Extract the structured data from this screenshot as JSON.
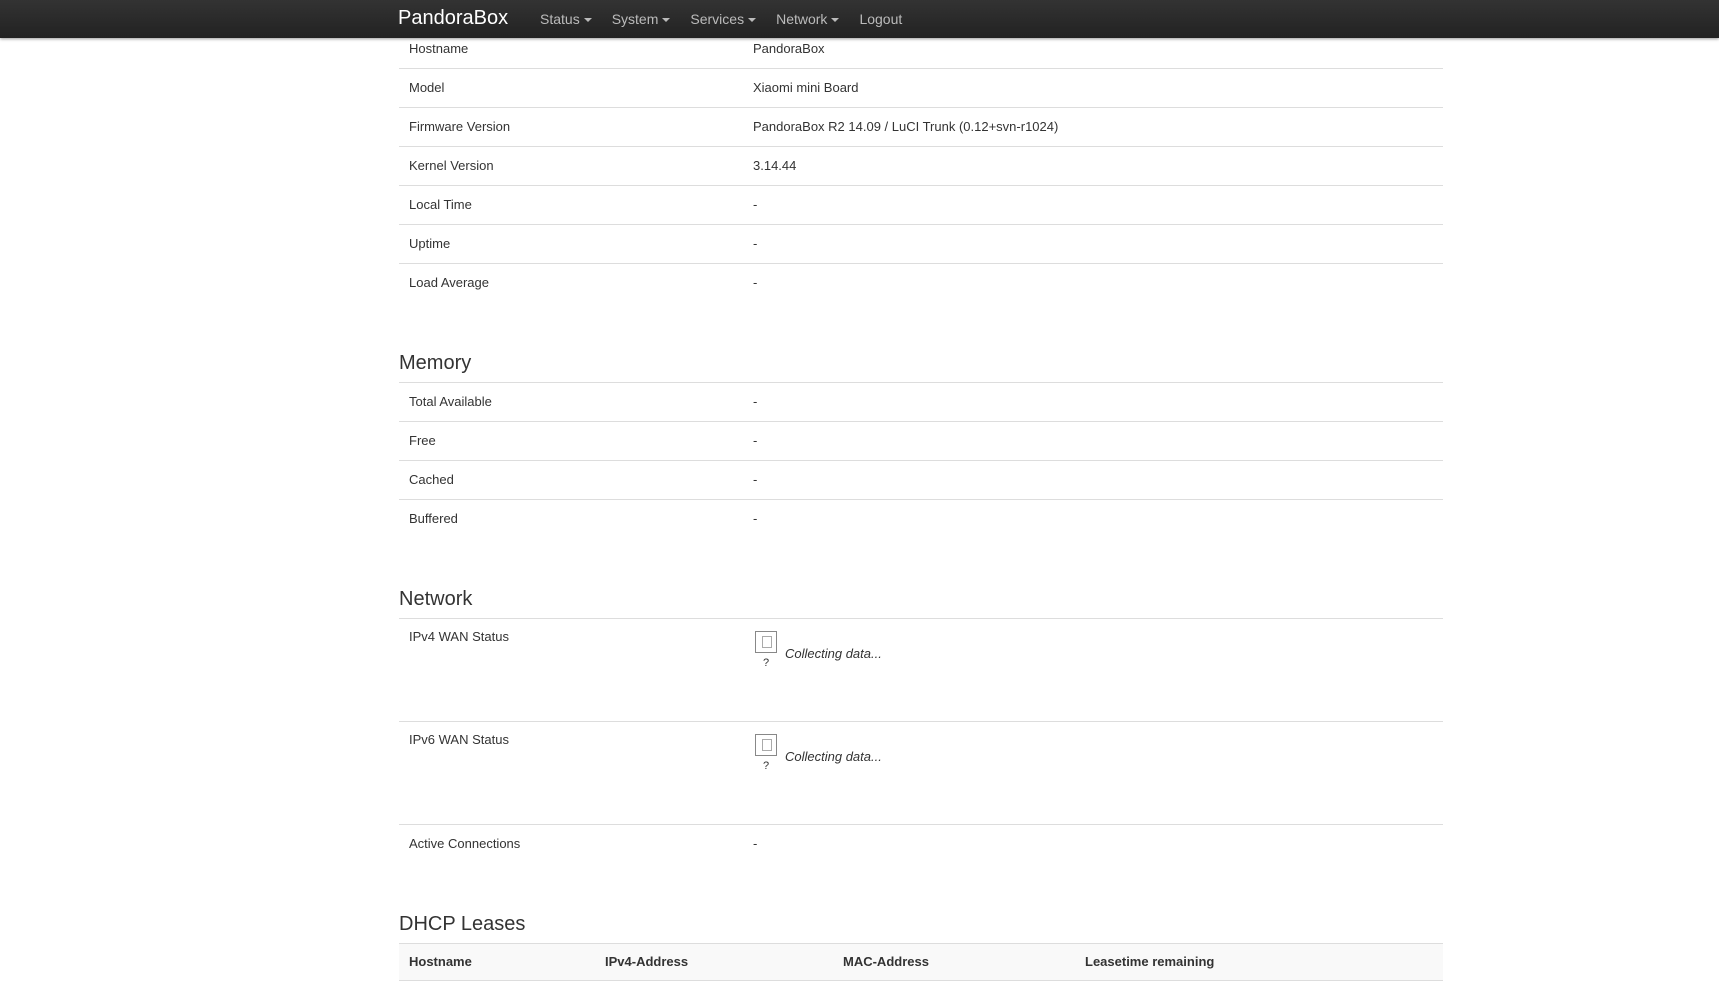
{
  "navbar": {
    "brand": "PandoraBox",
    "items": [
      {
        "label": "Status",
        "dropdown": true
      },
      {
        "label": "System",
        "dropdown": true
      },
      {
        "label": "Services",
        "dropdown": true
      },
      {
        "label": "Network",
        "dropdown": true
      },
      {
        "label": "Logout",
        "dropdown": false
      }
    ]
  },
  "system": {
    "rows": [
      {
        "label": "Hostname",
        "value": "PandoraBox"
      },
      {
        "label": "Model",
        "value": "Xiaomi mini Board"
      },
      {
        "label": "Firmware Version",
        "value": "PandoraBox R2 14.09 / LuCI Trunk (0.12+svn-r1024)"
      },
      {
        "label": "Kernel Version",
        "value": "3.14.44"
      },
      {
        "label": "Local Time",
        "value": "-"
      },
      {
        "label": "Uptime",
        "value": "-"
      },
      {
        "label": "Load Average",
        "value": "-"
      }
    ]
  },
  "memory": {
    "title": "Memory",
    "rows": [
      {
        "label": "Total Available",
        "value": "-"
      },
      {
        "label": "Free",
        "value": "-"
      },
      {
        "label": "Cached",
        "value": "-"
      },
      {
        "label": "Buffered",
        "value": "-"
      }
    ]
  },
  "network": {
    "title": "Network",
    "ipv4": {
      "label": "IPv4 WAN Status",
      "icon_text": "?",
      "status": "Collecting data..."
    },
    "ipv6": {
      "label": "IPv6 WAN Status",
      "icon_text": "?",
      "status": "Collecting data..."
    },
    "active": {
      "label": "Active Connections",
      "value": "-"
    }
  },
  "dhcp": {
    "title": "DHCP Leases",
    "columns": [
      "Hostname",
      "IPv4-Address",
      "MAC-Address",
      "Leasetime remaining"
    ]
  }
}
